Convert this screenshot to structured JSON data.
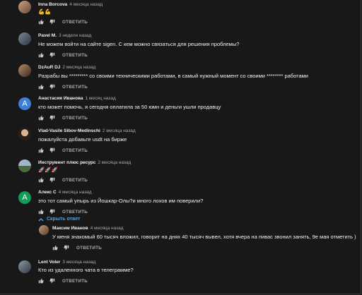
{
  "comments": [
    {
      "author": "Inna Borcova",
      "time": "4 месяца назад",
      "text": "💪💪",
      "reply": "ОТВЕТИТЬ"
    },
    {
      "author": "Pavel M.",
      "time": "3 недели назад",
      "text": "Не можем войти на сайте sigen. С кем можно связаться для решения проблемы?",
      "reply": "ОТВЕТИТЬ"
    },
    {
      "author": "DzAuR DJ",
      "time": "2 месяца назад",
      "text": "Разрабы вы ********* со своими техническими работами, в самый нужный момент со своими ******** работами",
      "reply": "ОТВЕТИТЬ"
    },
    {
      "author": "Анастасия Иванова",
      "time": "1 месяц назад",
      "text": "кто может помочь, я сегодня оплатила за 50 юмн и деньги ушли продавцу",
      "reply": "ОТВЕТИТЬ",
      "avatar_letter": "A"
    },
    {
      "author": "Vlad-Vasile Sibov-Medinschi",
      "time": "2 месяца назад",
      "text": "пожалуйста добавьте usdt на бирже",
      "reply": "ОТВЕТИТЬ"
    },
    {
      "author": "Инструмент плюс ресурс",
      "time": "2 месяца назад",
      "text": "🚀🚀🚀",
      "reply": "ОТВЕТИТЬ"
    },
    {
      "author": "Алекс С",
      "time": "4 месяца назад",
      "text": "это тот самый упырь из Йошкар-Олы?и много лохов им поверили?",
      "reply": "ОТВЕТИТЬ",
      "avatar_letter": "A",
      "replies_label": "Скрыть ответ"
    },
    {
      "author": "Lent Voler",
      "time": "3 месяца назад",
      "text": "Кто из удаленного чата в телеграмме?",
      "reply": "ОТВЕТИТЬ"
    }
  ],
  "nested_reply": {
    "author": "Максим Иванов",
    "time": "4 месяца назад",
    "text": "У меня знакомый 60 тысяч вложил, говорит на днях 40 тысяч вывел, хотя вчера на пивас звонил занять, 9е мая отметить )",
    "reply": "ОТВЕТИТЬ"
  },
  "colors": {
    "background": "#181818",
    "link": "#3ea6ff",
    "avatar_blue": "#3f7fd9",
    "avatar_green": "#0f9d58"
  }
}
